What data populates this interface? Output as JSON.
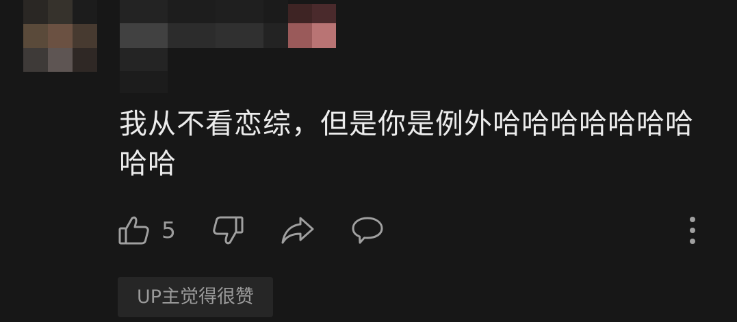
{
  "comment": {
    "text": "我从不看恋综，但是你是例外哈哈哈哈哈哈哈哈哈",
    "avatar_icon": "avatar-mosaic-icon",
    "username_icon": "username-mosaic-icon"
  },
  "actions": {
    "like_icon": "thumbs-up-icon",
    "like_count": "5",
    "dislike_icon": "thumbs-down-icon",
    "share_icon": "share-arrow-icon",
    "reply_icon": "speech-bubble-icon",
    "more_icon": "vertical-ellipsis-icon"
  },
  "badge": {
    "label": "UP主觉得很赞"
  },
  "colors": {
    "background": "#171717",
    "text": "#ececec",
    "muted": "#9c9c9c",
    "badge_bg": "#262626"
  }
}
